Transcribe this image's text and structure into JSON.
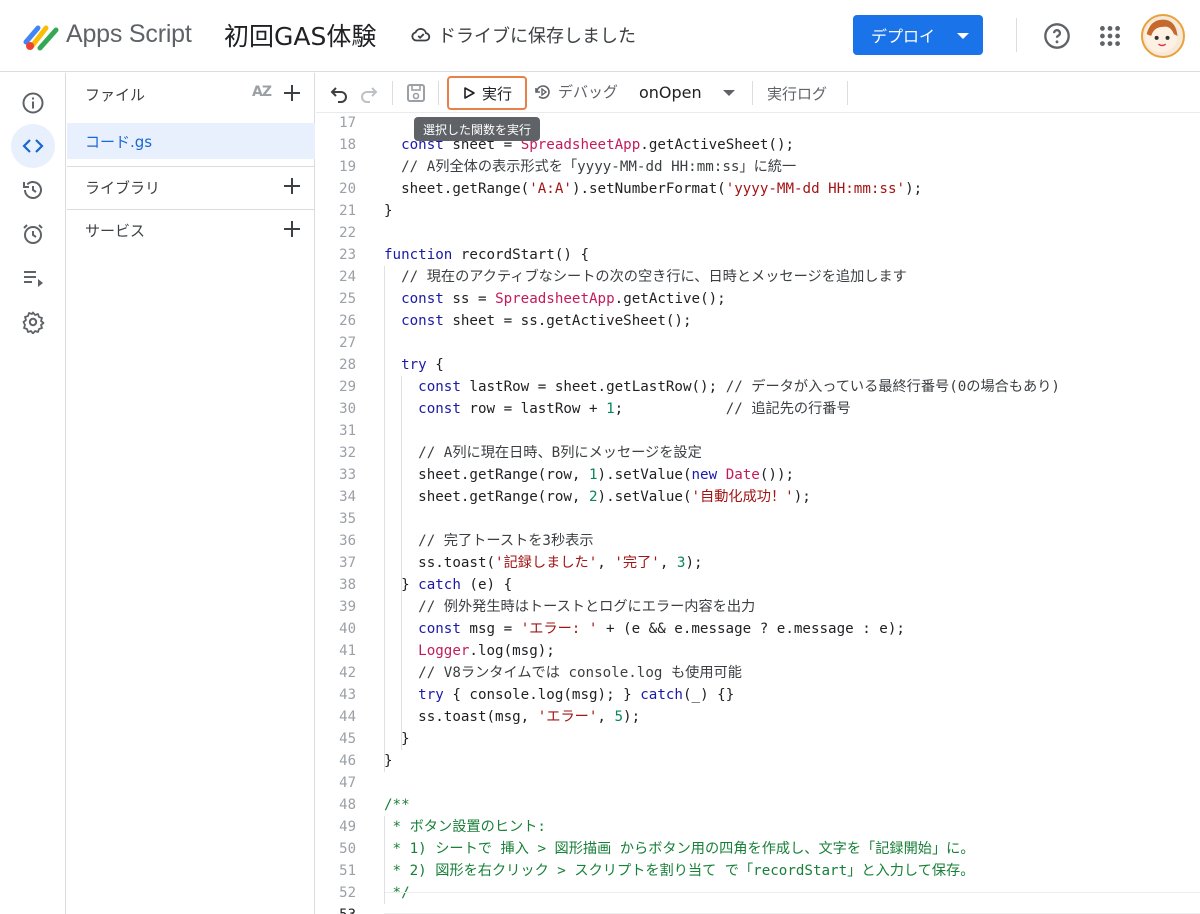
{
  "header": {
    "app_name": "Apps Script",
    "project_title": "初回GAS体験",
    "save_status": "ドライブに保存しました",
    "deploy_label": "デプロイ"
  },
  "files_panel": {
    "files_label": "ファイル",
    "sort_label": "AZ",
    "file_name": "コード.gs",
    "libraries_label": "ライブラリ",
    "services_label": "サービス"
  },
  "toolbar": {
    "run_label": "実行",
    "debug_label": "デバッグ",
    "function_name": "onOpen",
    "log_label": "実行ログ",
    "tooltip": "選択した関数を実行"
  },
  "editor": {
    "lines": [
      {
        "n": "17",
        "t": ""
      },
      {
        "n": "18",
        "t": "  const sheet = SpreadsheetApp.getActiveSheet();"
      },
      {
        "n": "19",
        "t": "  // A列全体の表示形式を「yyyy-MM-dd HH:mm:ss」に統一"
      },
      {
        "n": "20",
        "t": "  sheet.getRange('A:A').setNumberFormat('yyyy-MM-dd HH:mm:ss');"
      },
      {
        "n": "21",
        "t": "}"
      },
      {
        "n": "22",
        "t": ""
      },
      {
        "n": "23",
        "t": "function recordStart() {"
      },
      {
        "n": "24",
        "t": "  // 現在のアクティブなシートの次の空き行に、日時とメッセージを追加します"
      },
      {
        "n": "25",
        "t": "  const ss = SpreadsheetApp.getActive();"
      },
      {
        "n": "26",
        "t": "  const sheet = ss.getActiveSheet();"
      },
      {
        "n": "27",
        "t": ""
      },
      {
        "n": "28",
        "t": "  try {"
      },
      {
        "n": "29",
        "t": "    const lastRow = sheet.getLastRow(); // データが入っている最終行番号(0の場合もあり)"
      },
      {
        "n": "30",
        "t": "    const row = lastRow + 1;            // 追記先の行番号"
      },
      {
        "n": "31",
        "t": ""
      },
      {
        "n": "32",
        "t": "    // A列に現在日時、B列にメッセージを設定"
      },
      {
        "n": "33",
        "t": "    sheet.getRange(row, 1).setValue(new Date());"
      },
      {
        "n": "34",
        "t": "    sheet.getRange(row, 2).setValue('自動化成功！');"
      },
      {
        "n": "35",
        "t": ""
      },
      {
        "n": "36",
        "t": "    // 完了トーストを3秒表示"
      },
      {
        "n": "37",
        "t": "    ss.toast('記録しました', '完了', 3);"
      },
      {
        "n": "38",
        "t": "  } catch (e) {"
      },
      {
        "n": "39",
        "t": "    // 例外発生時はトーストとログにエラー内容を出力"
      },
      {
        "n": "40",
        "t": "    const msg = 'エラー: ' + (e && e.message ? e.message : e);"
      },
      {
        "n": "41",
        "t": "    Logger.log(msg);"
      },
      {
        "n": "42",
        "t": "    // V8ランタイムでは console.log も使用可能"
      },
      {
        "n": "43",
        "t": "    try { console.log(msg); } catch(_) {}"
      },
      {
        "n": "44",
        "t": "    ss.toast(msg, 'エラー', 5);"
      },
      {
        "n": "45",
        "t": "  }"
      },
      {
        "n": "46",
        "t": "}"
      },
      {
        "n": "47",
        "t": ""
      },
      {
        "n": "48",
        "t": "/**"
      },
      {
        "n": "49",
        "t": " * ボタン設置のヒント:"
      },
      {
        "n": "50",
        "t": " * 1) シートで 挿入 > 図形描画 からボタン用の四角を作成し、文字を「記録開始」に。"
      },
      {
        "n": "51",
        "t": " * 2) 図形を右クリック > スクリプトを割り当て で「recordStart」と入力して保存。"
      },
      {
        "n": "52",
        "t": " */"
      },
      {
        "n": "53",
        "t": ""
      }
    ]
  },
  "colors": {
    "accent": "#1a73e8",
    "run_outline": "#e8804a",
    "keyword": "#1a1aa6",
    "string": "#a31515",
    "class": "#c41a5a",
    "number": "#098658",
    "doc_comment": "#188038"
  },
  "icons": {
    "rail": [
      "info-icon",
      "code-icon",
      "history-icon",
      "alarm-icon",
      "executions-icon",
      "settings-icon"
    ]
  }
}
